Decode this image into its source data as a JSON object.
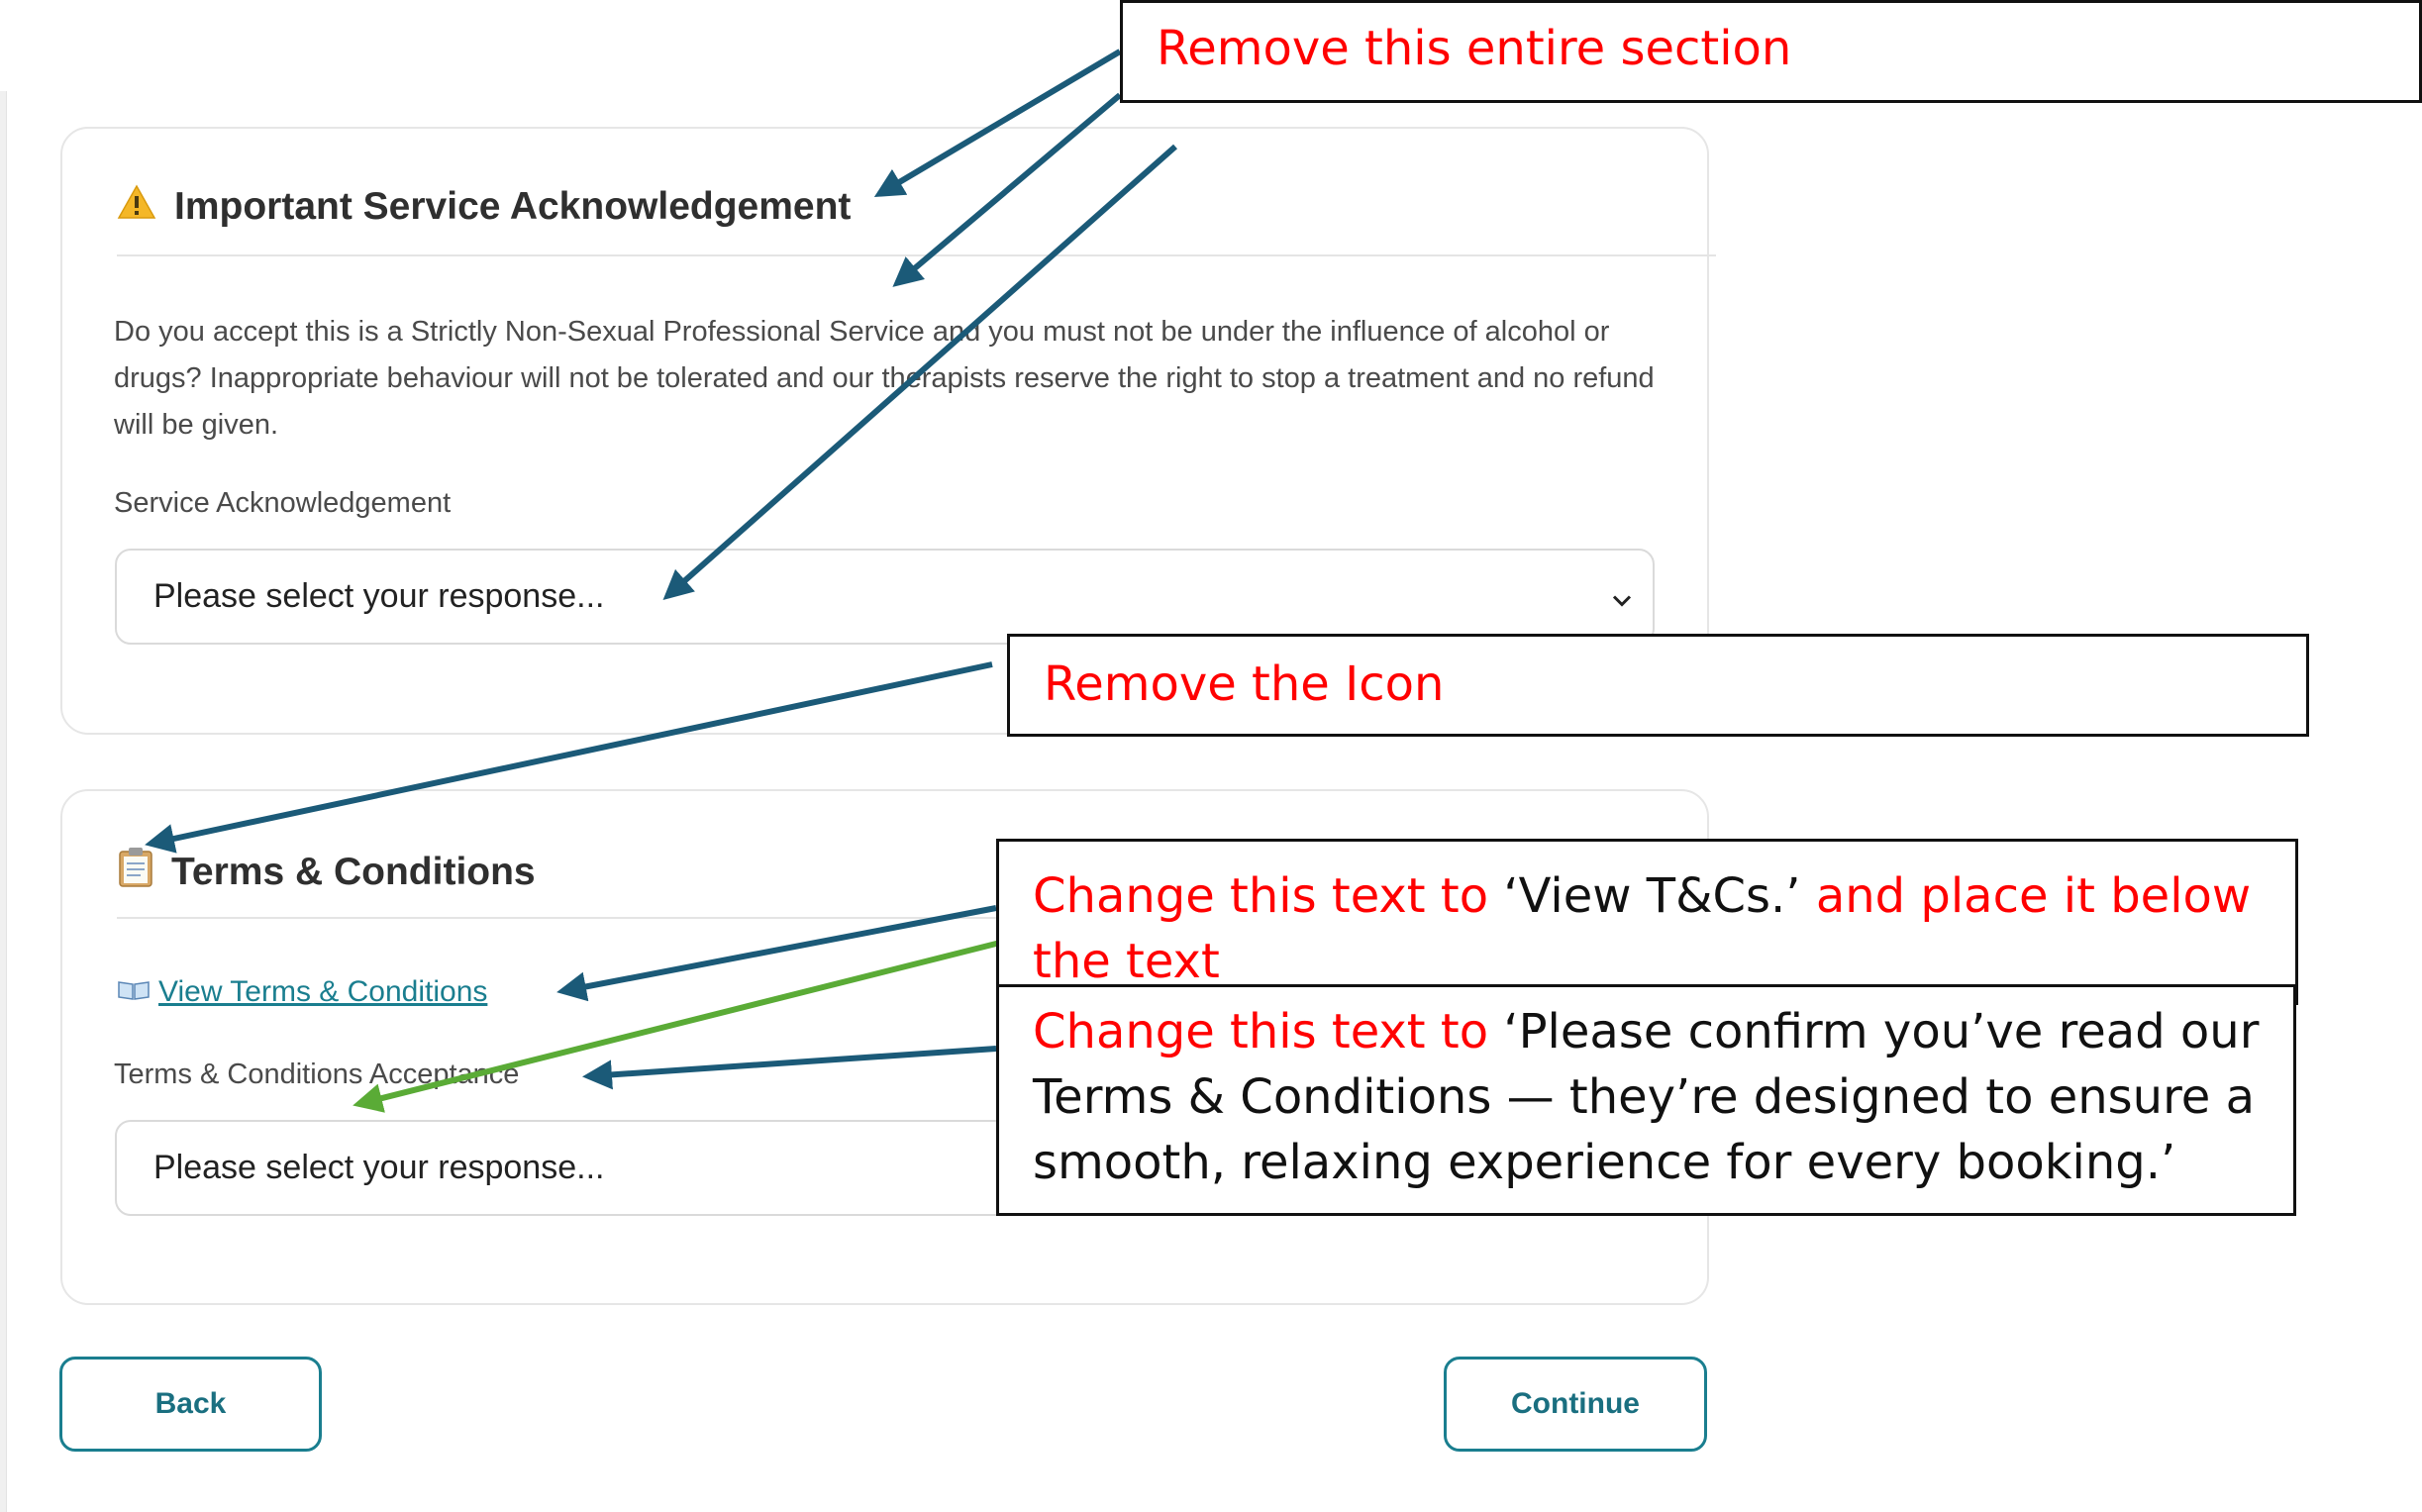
{
  "section1": {
    "title": "Important Service Acknowledgement",
    "icon": "warning-icon",
    "description": "Do you accept this is a Strictly Non-Sexual Professional Service and you must not be under the influence of alcohol or drugs? Inappropriate behaviour will not be tolerated and our therapists reserve the right to stop a treatment and no refund will be given.",
    "field_label": "Service Acknowledgement",
    "select_value": "Please select your response..."
  },
  "section2": {
    "title": "Terms & Conditions",
    "icon": "clipboard-icon",
    "link_text": "View Terms & Conditions",
    "link_icon": "book-icon",
    "field_label": "Terms & Conditions Acceptance",
    "select_value": "Please select your response..."
  },
  "buttons": {
    "back": "Back",
    "continue": "Continue"
  },
  "annotations": {
    "remove_section": "Remove this entire section",
    "remove_icon": "Remove the Icon",
    "change_link_prefix": "Change this text to",
    "change_link_quote": "‘View T&Cs.’",
    "change_link_suffix": "and place it below the text",
    "change_label_prefix": "Change this text to",
    "change_label_quote": "‘Please confirm you’ve read our Terms & Conditions — they’re designed to ensure a smooth, relaxing experience for every booking.’"
  },
  "colors": {
    "accent": "#1a7e8f",
    "annotation_red": "#ff0000",
    "arrow_blue": "#1b5a78",
    "arrow_green": "#5aab36"
  }
}
